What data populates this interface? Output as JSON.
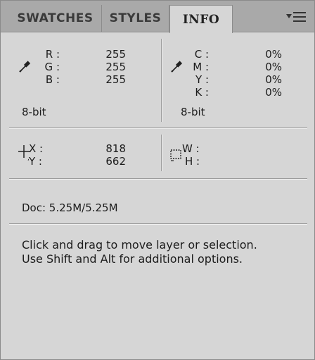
{
  "tabs": [
    {
      "label": "SWATCHES",
      "active": false
    },
    {
      "label": "STYLES",
      "active": false
    },
    {
      "label": "INFO",
      "active": true
    }
  ],
  "rgb": {
    "labels": [
      "R :",
      "G :",
      "B :"
    ],
    "values": [
      "255",
      "255",
      "255"
    ],
    "bit_depth": "8-bit"
  },
  "cmyk": {
    "labels": [
      "C :",
      "M :",
      "Y :",
      "K :"
    ],
    "values": [
      "0%",
      "0%",
      "0%",
      "0%"
    ],
    "bit_depth": "8-bit"
  },
  "position": {
    "x_label": "X :",
    "y_label": "Y :",
    "x_value": "818",
    "y_value": "662"
  },
  "size": {
    "w_label": "W :",
    "h_label": "H :"
  },
  "doc": "Doc: 5.25M/5.25M",
  "hint": {
    "line1": "Click and drag to move layer or selection.",
    "line2": "Use Shift and Alt for additional options."
  },
  "icons": {
    "rgb_sampler": "eyedropper-icon",
    "cmyk_sampler": "eyedropper-icon",
    "position": "crosshair-icon",
    "size": "marquee-selection-icon",
    "menu": "panel-menu-icon"
  },
  "colors": {
    "panel_bg": "#d6d6d6",
    "tabbar_bg": "#a9a9a9"
  }
}
